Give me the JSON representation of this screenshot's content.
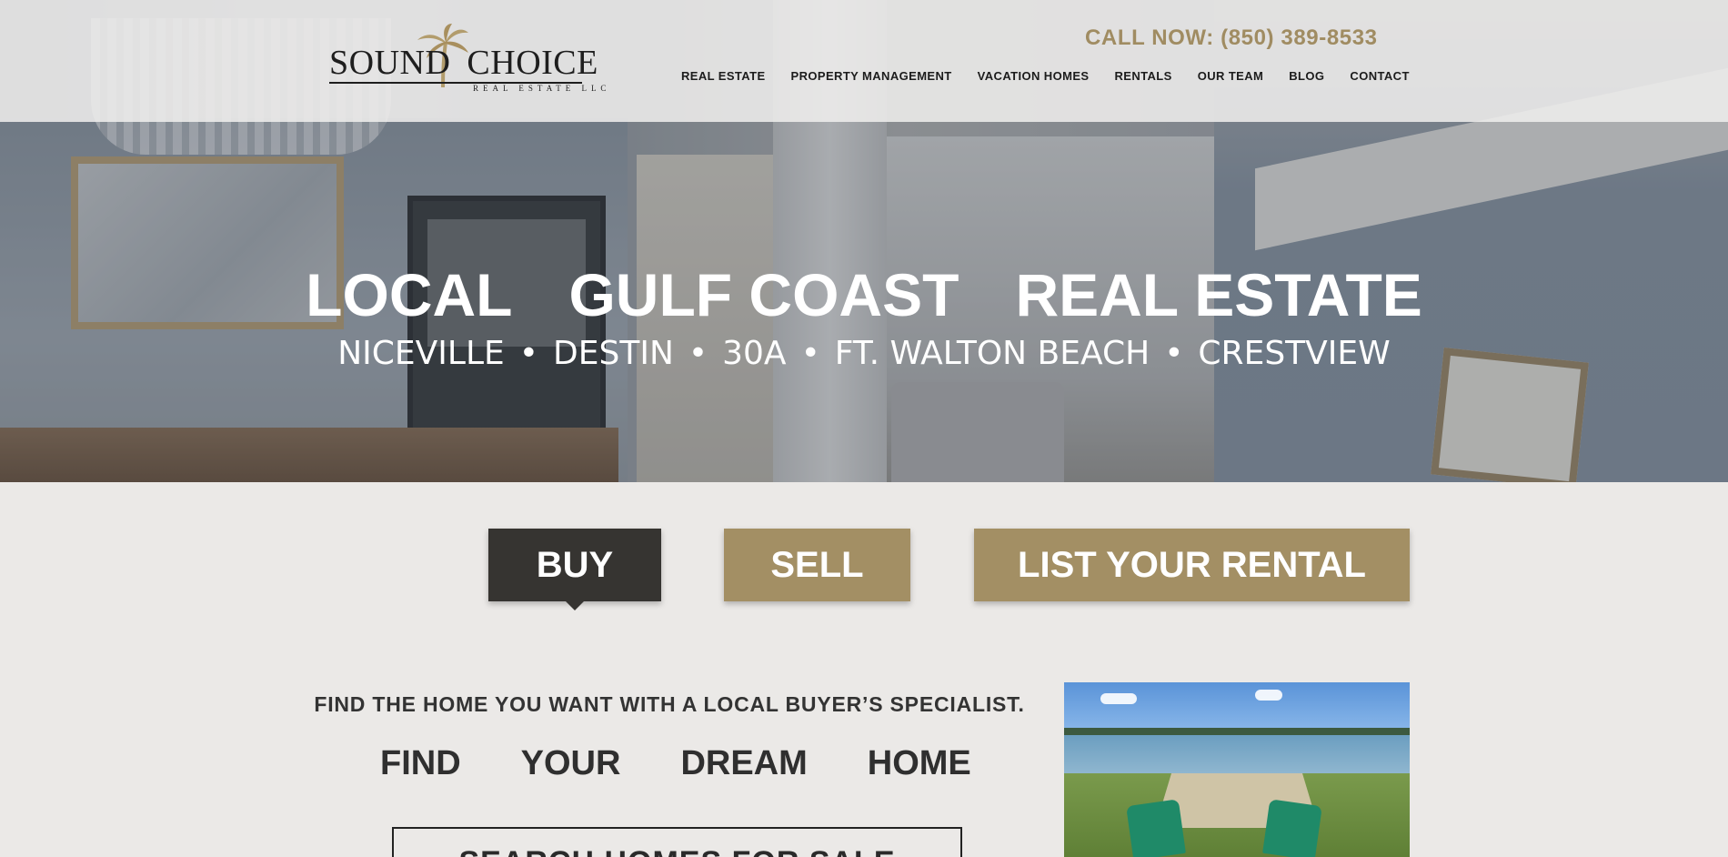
{
  "header": {
    "logo_main": "SOUND",
    "logo_main2": "CHOICE",
    "logo_sub": "REAL ESTATE LLC",
    "call_now": "CALL NOW: (850) 389-8533",
    "nav": [
      "REAL ESTATE",
      "PROPERTY MANAGEMENT",
      "VACATION HOMES",
      "RENTALS",
      "OUR TEAM",
      "BLOG",
      "CONTACT"
    ]
  },
  "hero": {
    "title_words": [
      "LOCAL",
      "GULF COAST",
      "REAL ESTATE"
    ],
    "locations": [
      "NICEVILLE",
      "DESTIN",
      "30A",
      "FT. WALTON BEACH",
      "CRESTVIEW"
    ],
    "separator": "•"
  },
  "tabs": {
    "buy": "BUY",
    "sell": "SELL",
    "rental": "LIST YOUR RENTAL",
    "active": "buy"
  },
  "buy_panel": {
    "tagline": "FIND THE HOME YOU WANT WITH A LOCAL BUYER’S SPECIALIST.",
    "headline_words": [
      "FIND",
      "YOUR",
      "DREAM",
      "HOME"
    ],
    "search_button": "SEARCH HOMES FOR SALE"
  },
  "colors": {
    "accent_gold": "#a38f64",
    "dark": "#363431",
    "background": "#ebe9e7"
  },
  "icons": [
    "palm-tree-icon"
  ]
}
